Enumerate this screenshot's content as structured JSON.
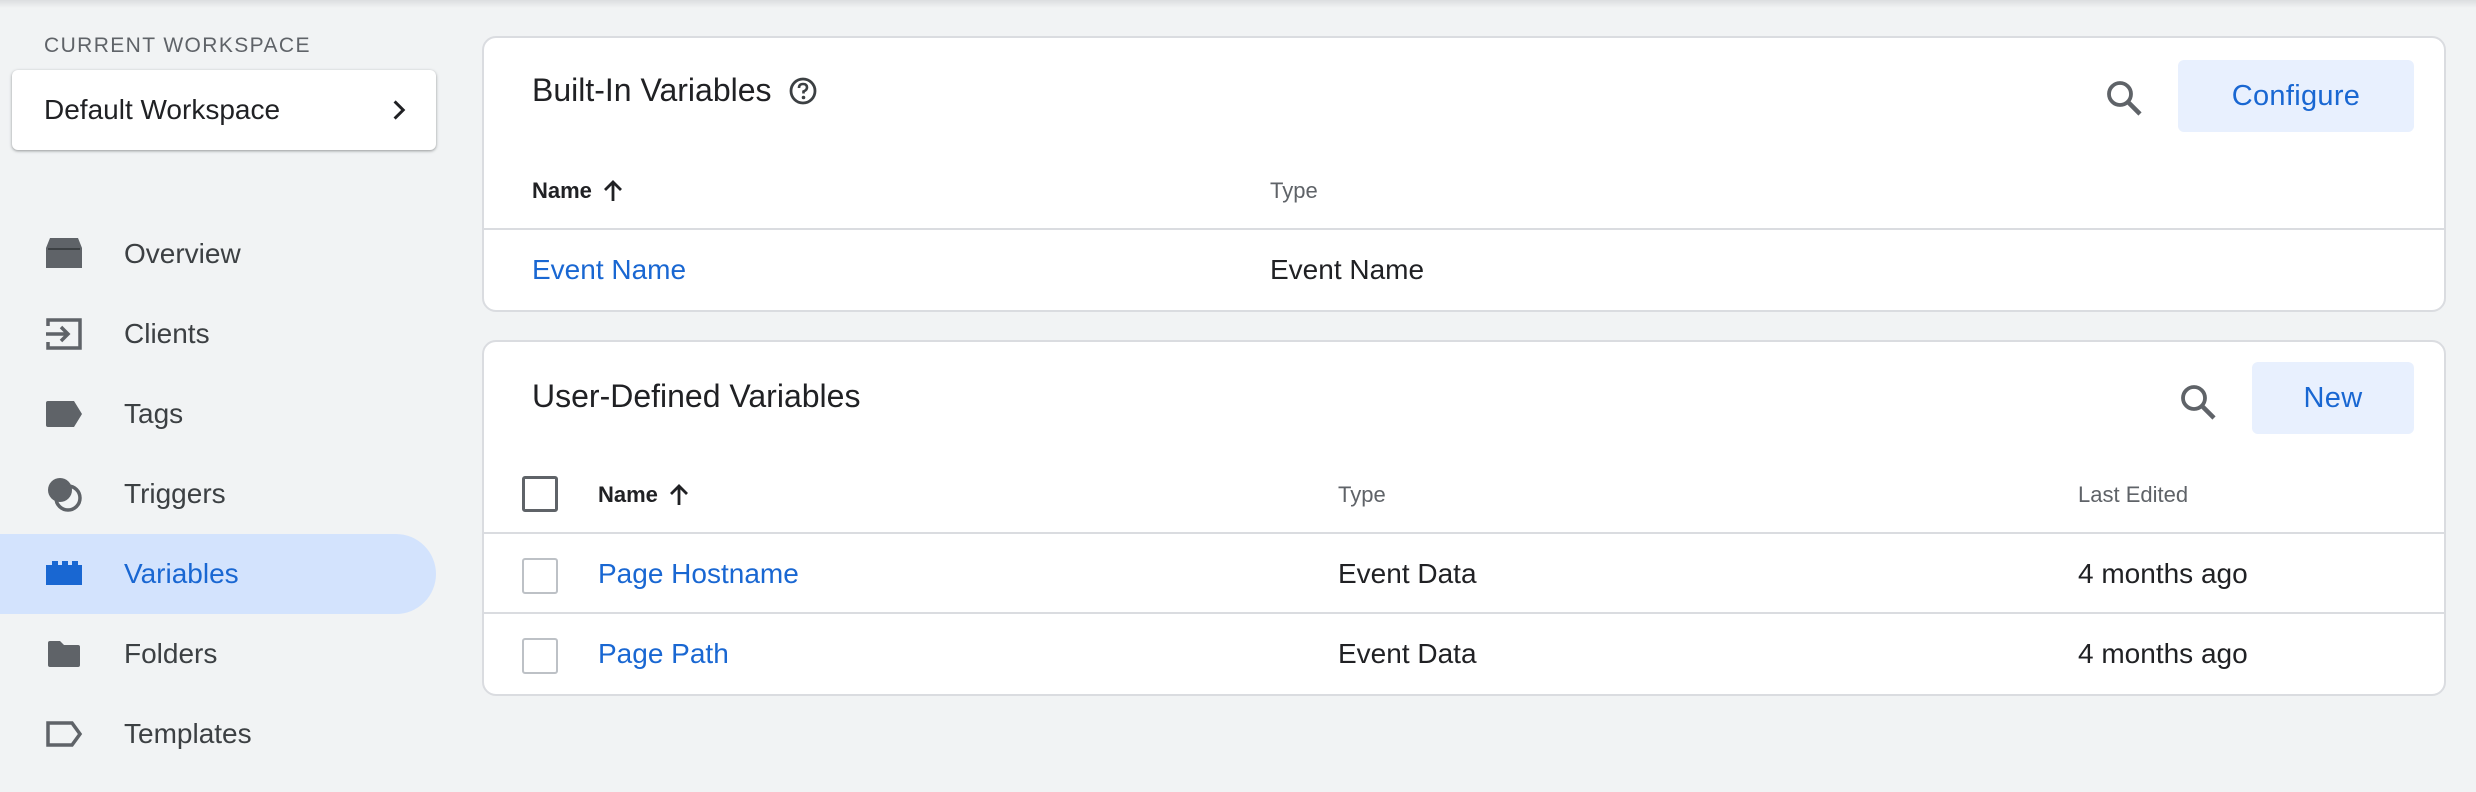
{
  "sidebar": {
    "workspace_label": "CURRENT WORKSPACE",
    "workspace_name": "Default Workspace",
    "items": [
      {
        "label": "Overview",
        "icon": "overview-icon"
      },
      {
        "label": "Clients",
        "icon": "clients-icon"
      },
      {
        "label": "Tags",
        "icon": "tag-icon"
      },
      {
        "label": "Triggers",
        "icon": "triggers-icon"
      },
      {
        "label": "Variables",
        "icon": "variables-icon",
        "active": true
      },
      {
        "label": "Folders",
        "icon": "folder-icon"
      },
      {
        "label": "Templates",
        "icon": "templates-icon"
      }
    ]
  },
  "builtin": {
    "title": "Built-In Variables",
    "configure_label": "Configure",
    "columns": {
      "name": "Name",
      "type": "Type"
    },
    "rows": [
      {
        "name": "Event Name",
        "type": "Event Name"
      }
    ]
  },
  "userdefined": {
    "title": "User-Defined Variables",
    "new_label": "New",
    "columns": {
      "name": "Name",
      "type": "Type",
      "last_edited": "Last Edited"
    },
    "rows": [
      {
        "name": "Page Hostname",
        "type": "Event Data",
        "last_edited": "4 months ago"
      },
      {
        "name": "Page Path",
        "type": "Event Data",
        "last_edited": "4 months ago"
      }
    ]
  },
  "colors": {
    "accent": "#1967d2",
    "active_nav_bg": "#d3e3fd",
    "button_bg": "#e8f0fe",
    "background": "#f1f3f4"
  }
}
